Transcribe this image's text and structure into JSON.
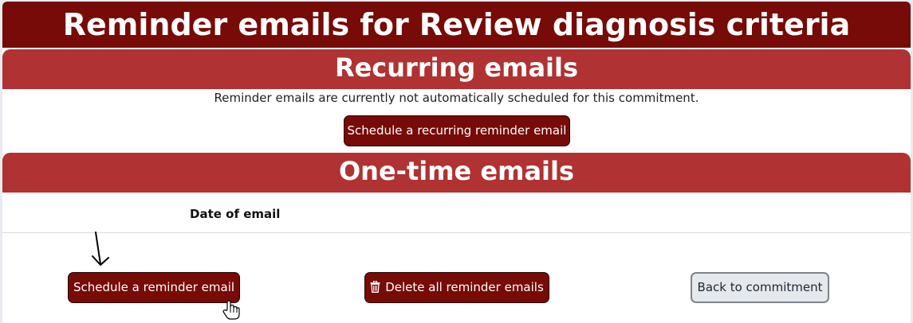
{
  "page": {
    "title": "Reminder emails for Review diagnosis criteria"
  },
  "recurring": {
    "heading": "Recurring emails",
    "status_text": "Reminder emails are currently not automatically scheduled for this commitment.",
    "schedule_button": "Schedule a recurring reminder email"
  },
  "one_time": {
    "heading": "One-time emails",
    "table": {
      "columns": [
        "Date of email"
      ],
      "rows": []
    }
  },
  "actions": {
    "schedule_button": "Schedule a reminder email",
    "delete_all_button": "Delete all reminder emails",
    "delete_icon": "trash-icon",
    "back_button": "Back to commitment"
  },
  "colors": {
    "title_bg": "#760b08",
    "section_bg": "#b03232",
    "button_dark": "#760b08",
    "button_light": "#e5e8ec"
  }
}
